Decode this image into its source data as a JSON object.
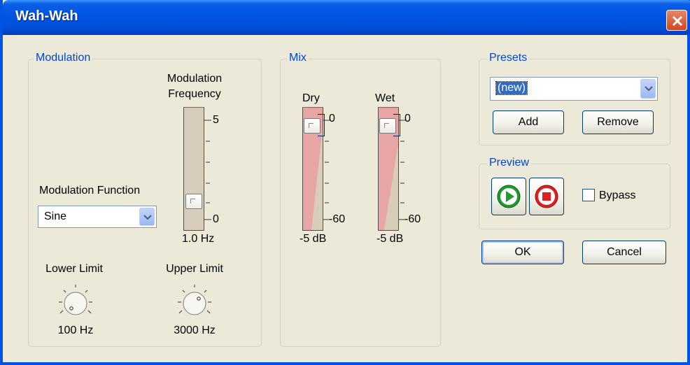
{
  "window": {
    "title": "Wah-Wah",
    "close_icon": "close-icon"
  },
  "modulation": {
    "legend": "Modulation",
    "freq_label_line1": "Modulation",
    "freq_label_line2": "Frequency",
    "freq_scale_max": "5",
    "freq_scale_min": "0",
    "freq_value": "1.0 Hz",
    "function_label": "Modulation Function",
    "function_value": "Sine",
    "lower_limit_label": "Lower Limit",
    "lower_limit_value": "100 Hz",
    "upper_limit_label": "Upper Limit",
    "upper_limit_value": "3000 Hz"
  },
  "mix": {
    "legend": "Mix",
    "dry_label": "Dry",
    "wet_label": "Wet",
    "dry_scale_max": "0",
    "dry_scale_min": "-60",
    "wet_scale_max": "0",
    "wet_scale_min": "-60",
    "dry_value": "-5 dB",
    "wet_value": "-5 dB"
  },
  "presets": {
    "legend": "Presets",
    "selected": "(new)",
    "add_label": "Add",
    "remove_label": "Remove"
  },
  "preview": {
    "legend": "Preview",
    "play_icon": "play-icon",
    "stop_icon": "stop-icon",
    "bypass_label": "Bypass",
    "bypass_checked": false
  },
  "dialog": {
    "ok_label": "OK",
    "cancel_label": "Cancel"
  },
  "colors": {
    "title_blue": "#0054e3",
    "legend_blue": "#0046d5",
    "face": "#ece9d8"
  }
}
